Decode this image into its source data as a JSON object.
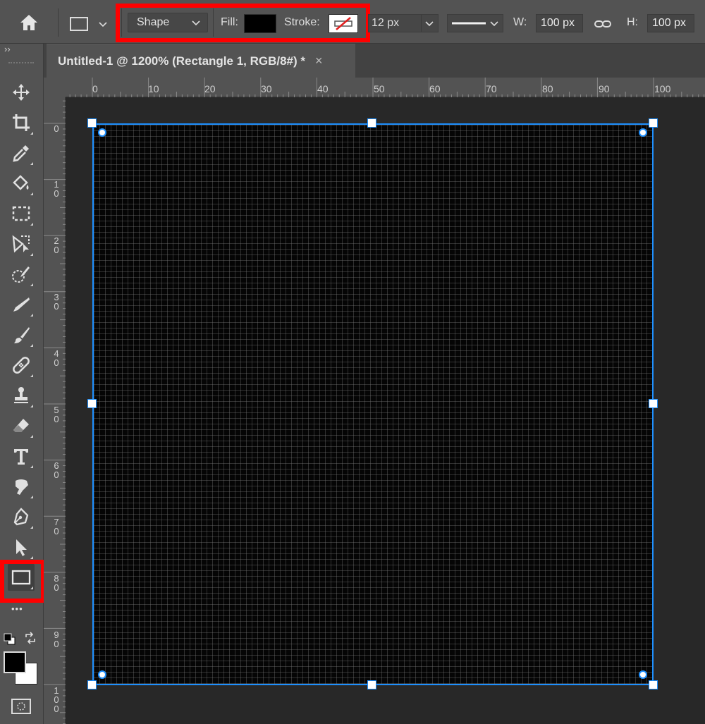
{
  "options_bar": {
    "tool_mode": "Shape",
    "fill_label": "Fill:",
    "fill_color": "#000000",
    "stroke_label": "Stroke:",
    "stroke_width": "12 px",
    "width_label": "W:",
    "width_value": "100 px",
    "height_label": "H:",
    "height_value": "100 px"
  },
  "toolbar": {
    "collapse_glyph": "››",
    "tools": [
      "move-icon",
      "crop-icon",
      "eyedropper-icon",
      "paint-bucket-icon",
      "rectangular-marquee-icon",
      "object-selection-icon",
      "quick-selection-icon",
      "smudge-icon",
      "brush-icon",
      "healing-brush-icon",
      "clone-stamp-icon",
      "eraser-icon",
      "type-icon",
      "finger-paint-icon",
      "pen-icon",
      "path-selection-icon",
      "rectangle-tool-icon"
    ],
    "more_glyph": "•••",
    "foreground_color": "#000000",
    "background_color": "#ffffff"
  },
  "document": {
    "tab_title": "Untitled-1 @ 1200% (Rectangle 1, RGB/8#) *",
    "close_glyph": "×"
  },
  "rulers": {
    "horizontal": [
      "0",
      "10",
      "20",
      "30",
      "40",
      "50",
      "60",
      "70",
      "80",
      "90",
      "100"
    ],
    "vertical": [
      "0",
      "10",
      "20",
      "30",
      "40",
      "50",
      "60",
      "70",
      "80",
      "90",
      "100"
    ]
  },
  "colors": {
    "accent": "#1e90ff",
    "highlight": "#ff0000",
    "panel": "#535353",
    "canvas_bg": "#282828"
  }
}
